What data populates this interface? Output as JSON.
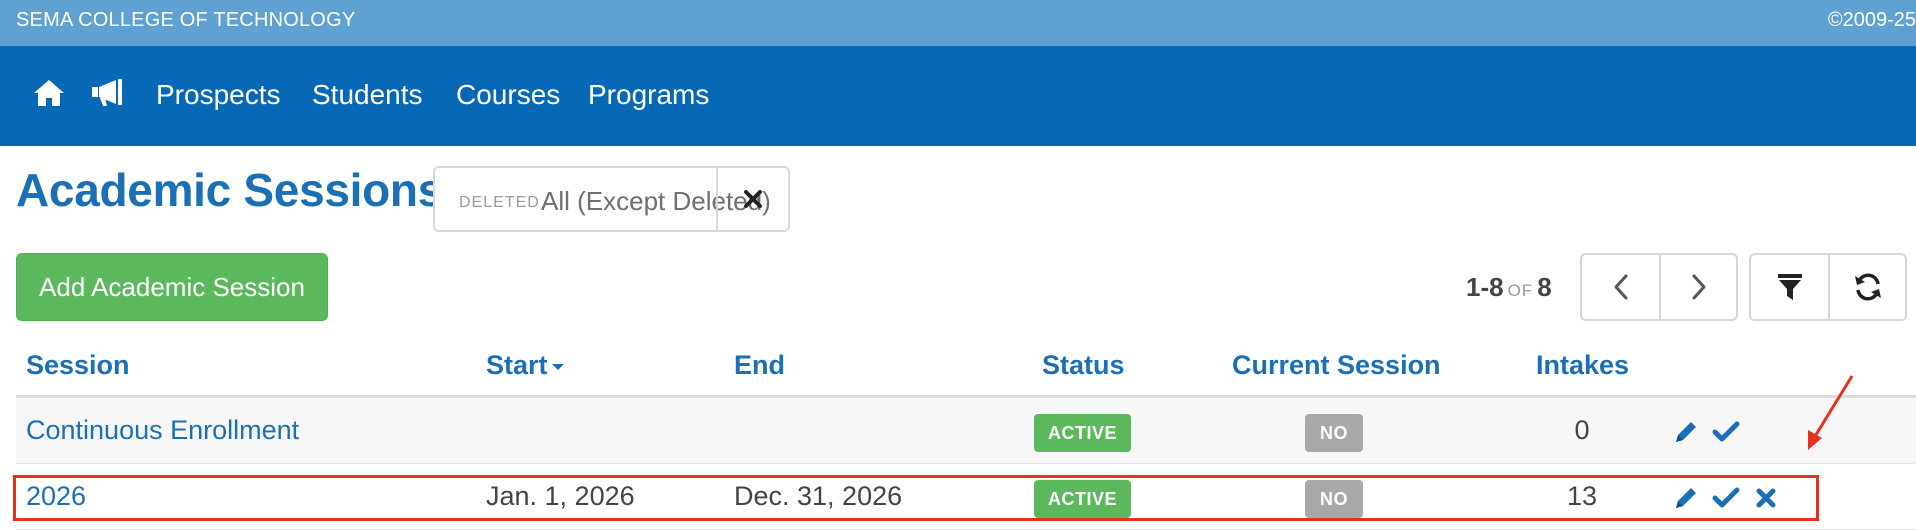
{
  "topbar": {
    "org_name": "SEMA COLLEGE OF TECHNOLOGY",
    "copyright": "©2009-25"
  },
  "nav": {
    "icons": [
      "home-icon",
      "bullhorn-icon"
    ],
    "links": [
      "Prospects",
      "Students",
      "Courses",
      "Programs"
    ]
  },
  "page": {
    "title": "Academic Sessions"
  },
  "filter": {
    "label": "DELETED",
    "value": "All (Except Deleted)"
  },
  "actions": {
    "add_label": "Add Academic Session"
  },
  "pagination": {
    "range": "1-8",
    "of_label": "OF",
    "total": "8"
  },
  "table": {
    "columns": [
      "Session",
      "Start",
      "End",
      "Status",
      "Current Session",
      "Intakes"
    ],
    "sort_column": "Start",
    "rows": [
      {
        "session": "Continuous Enrollment",
        "start": "",
        "end": "",
        "status": "ACTIVE",
        "current": "NO",
        "intakes": "0",
        "actions": [
          "pencil-icon",
          "check-icon"
        ]
      },
      {
        "session": "2026",
        "start": "Jan. 1, 2026",
        "end": "Dec. 31, 2026",
        "status": "ACTIVE",
        "current": "NO",
        "intakes": "13",
        "actions": [
          "pencil-icon",
          "check-icon",
          "close-icon"
        ]
      }
    ]
  },
  "colors": {
    "topbar": "#5fa2d2",
    "nav": "#0769b5",
    "primary_text": "#1a6fb5",
    "success": "#5cb85c",
    "muted_badge": "#a8a8a8",
    "highlight": "#e5321f"
  }
}
